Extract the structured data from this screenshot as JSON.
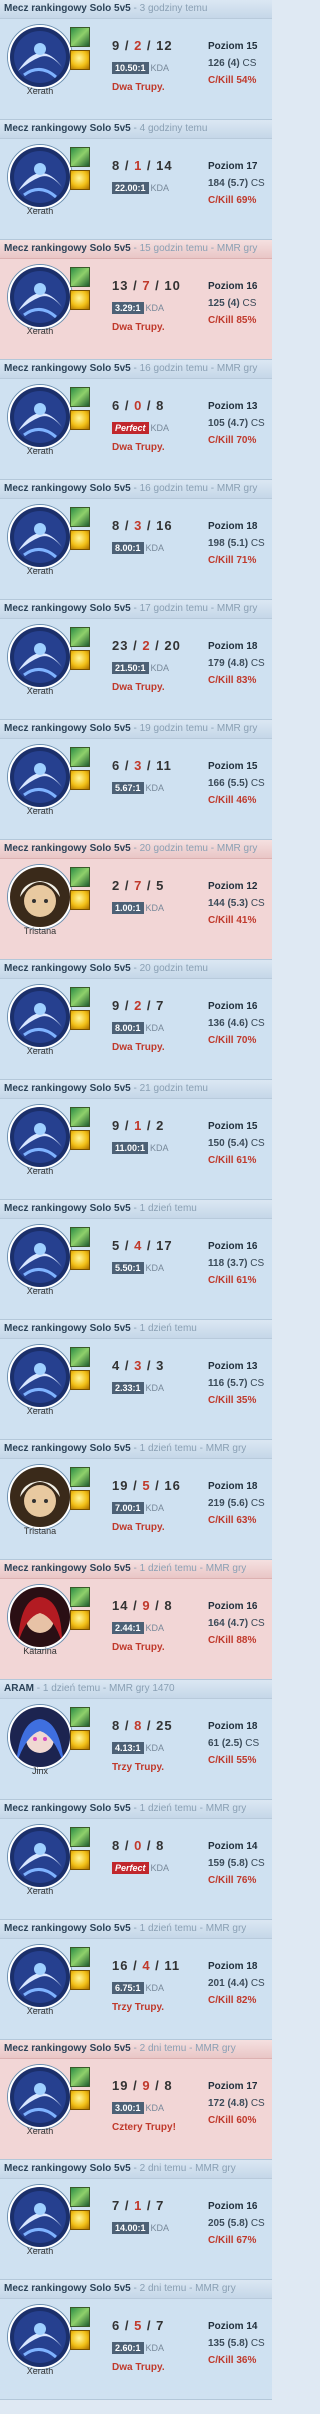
{
  "matches": [
    {
      "result": "win",
      "queue": "Mecz rankingowy Solo 5v5",
      "ago": " - 3 godziny temu",
      "champion": "Xerath",
      "kda": {
        "k": "9",
        "d": "2",
        "a": "12"
      },
      "ratio": "10.50:1",
      "ratio_label": "KDA",
      "multikill": "Dwa Trupy.",
      "level": "Poziom 15",
      "cs": "126 (4)",
      "cs_label": "CS",
      "ckill": "C/Kill 54%"
    },
    {
      "result": "win",
      "queue": "Mecz rankingowy Solo 5v5",
      "ago": " - 4 godziny temu",
      "champion": "Xerath",
      "kda": {
        "k": "8",
        "d": "1",
        "a": "14"
      },
      "ratio": "22.00:1",
      "ratio_label": "KDA",
      "multikill": "",
      "level": "Poziom 17",
      "cs": "184 (5.7)",
      "cs_label": "CS",
      "ckill": "C/Kill 69%"
    },
    {
      "result": "loss",
      "queue": "Mecz rankingowy Solo 5v5",
      "ago": " - 15 godzin temu - MMR gry",
      "champion": "Xerath",
      "kda": {
        "k": "13",
        "d": "7",
        "a": "10"
      },
      "ratio": "3.29:1",
      "ratio_label": "KDA",
      "multikill": "Dwa Trupy.",
      "level": "Poziom 16",
      "cs": "125 (4)",
      "cs_label": "CS",
      "ckill": "C/Kill 85%"
    },
    {
      "result": "win",
      "queue": "Mecz rankingowy Solo 5v5",
      "ago": " - 16 godzin temu - MMR gry",
      "champion": "Xerath",
      "kda": {
        "k": "6",
        "d": "0",
        "a": "8"
      },
      "ratio": "Perfect",
      "ratio_label": "KDA",
      "multikill": "Dwa Trupy.",
      "level": "Poziom 13",
      "cs": "105 (4.7)",
      "cs_label": "CS",
      "ckill": "C/Kill 70%"
    },
    {
      "result": "win",
      "queue": "Mecz rankingowy Solo 5v5",
      "ago": " - 16 godzin temu - MMR gry",
      "champion": "Xerath",
      "kda": {
        "k": "8",
        "d": "3",
        "a": "16"
      },
      "ratio": "8.00:1",
      "ratio_label": "KDA",
      "multikill": "",
      "level": "Poziom 18",
      "cs": "198 (5.1)",
      "cs_label": "CS",
      "ckill": "C/Kill 71%"
    },
    {
      "result": "win",
      "queue": "Mecz rankingowy Solo 5v5",
      "ago": " - 17 godzin temu - MMR gry",
      "champion": "Xerath",
      "kda": {
        "k": "23",
        "d": "2",
        "a": "20"
      },
      "ratio": "21.50:1",
      "ratio_label": "KDA",
      "multikill": "Dwa Trupy.",
      "level": "Poziom 18",
      "cs": "179 (4.8)",
      "cs_label": "CS",
      "ckill": "C/Kill 83%"
    },
    {
      "result": "win",
      "queue": "Mecz rankingowy Solo 5v5",
      "ago": " - 19 godzin temu - MMR gry",
      "champion": "Xerath",
      "kda": {
        "k": "6",
        "d": "3",
        "a": "11"
      },
      "ratio": "5.67:1",
      "ratio_label": "KDA",
      "multikill": "",
      "level": "Poziom 15",
      "cs": "166 (5.5)",
      "cs_label": "CS",
      "ckill": "C/Kill 46%"
    },
    {
      "result": "loss",
      "queue": "Mecz rankingowy Solo 5v5",
      "ago": " - 20 godzin temu - MMR gry",
      "champion": "Tristana",
      "kda": {
        "k": "2",
        "d": "7",
        "a": "5"
      },
      "ratio": "1.00:1",
      "ratio_label": "KDA",
      "multikill": "",
      "level": "Poziom 12",
      "cs": "144 (5.3)",
      "cs_label": "CS",
      "ckill": "C/Kill 41%"
    },
    {
      "result": "win",
      "queue": "Mecz rankingowy Solo 5v5",
      "ago": " - 20 godzin temu",
      "champion": "Xerath",
      "kda": {
        "k": "9",
        "d": "2",
        "a": "7"
      },
      "ratio": "8.00:1",
      "ratio_label": "KDA",
      "multikill": "Dwa Trupy.",
      "level": "Poziom 16",
      "cs": "136 (4.6)",
      "cs_label": "CS",
      "ckill": "C/Kill 70%"
    },
    {
      "result": "win",
      "queue": "Mecz rankingowy Solo 5v5",
      "ago": " - 21 godzin temu",
      "champion": "Xerath",
      "kda": {
        "k": "9",
        "d": "1",
        "a": "2"
      },
      "ratio": "11.00:1",
      "ratio_label": "KDA",
      "multikill": "",
      "level": "Poziom 15",
      "cs": "150 (5.4)",
      "cs_label": "CS",
      "ckill": "C/Kill 61%"
    },
    {
      "result": "win",
      "queue": "Mecz rankingowy Solo 5v5",
      "ago": " - 1 dzień temu",
      "champion": "Xerath",
      "kda": {
        "k": "5",
        "d": "4",
        "a": "17"
      },
      "ratio": "5.50:1",
      "ratio_label": "KDA",
      "multikill": "",
      "level": "Poziom 16",
      "cs": "118 (3.7)",
      "cs_label": "CS",
      "ckill": "C/Kill 61%"
    },
    {
      "result": "win",
      "queue": "Mecz rankingowy Solo 5v5",
      "ago": " - 1 dzień temu",
      "champion": "Xerath",
      "kda": {
        "k": "4",
        "d": "3",
        "a": "3"
      },
      "ratio": "2.33:1",
      "ratio_label": "KDA",
      "multikill": "",
      "level": "Poziom 13",
      "cs": "116 (5.7)",
      "cs_label": "CS",
      "ckill": "C/Kill 35%"
    },
    {
      "result": "win",
      "queue": "Mecz rankingowy Solo 5v5",
      "ago": " - 1 dzień temu - MMR gry",
      "champion": "Tristana",
      "kda": {
        "k": "19",
        "d": "5",
        "a": "16"
      },
      "ratio": "7.00:1",
      "ratio_label": "KDA",
      "multikill": "Dwa Trupy.",
      "level": "Poziom 18",
      "cs": "219 (5.6)",
      "cs_label": "CS",
      "ckill": "C/Kill 63%"
    },
    {
      "result": "loss",
      "queue": "Mecz rankingowy Solo 5v5",
      "ago": " - 1 dzień temu - MMR gry",
      "champion": "Katarina",
      "kda": {
        "k": "14",
        "d": "9",
        "a": "8"
      },
      "ratio": "2.44:1",
      "ratio_label": "KDA",
      "multikill": "Dwa Trupy.",
      "level": "Poziom 16",
      "cs": "164 (4.7)",
      "cs_label": "CS",
      "ckill": "C/Kill 88%"
    },
    {
      "result": "win",
      "queue": "ARAM",
      "ago": " - 1 dzień temu - MMR gry 1470",
      "champion": "Jinx",
      "kda": {
        "k": "8",
        "d": "8",
        "a": "25"
      },
      "ratio": "4.13:1",
      "ratio_label": "KDA",
      "multikill": "Trzy Trupy.",
      "level": "Poziom 18",
      "cs": "61 (2.5)",
      "cs_label": "CS",
      "ckill": "C/Kill 55%"
    },
    {
      "result": "win",
      "queue": "Mecz rankingowy Solo 5v5",
      "ago": " - 1 dzień temu - MMR gry",
      "champion": "Xerath",
      "kda": {
        "k": "8",
        "d": "0",
        "a": "8"
      },
      "ratio": "Perfect",
      "ratio_label": "KDA",
      "multikill": "",
      "level": "Poziom 14",
      "cs": "159 (5.8)",
      "cs_label": "CS",
      "ckill": "C/Kill 76%"
    },
    {
      "result": "win",
      "queue": "Mecz rankingowy Solo 5v5",
      "ago": " - 1 dzień temu - MMR gry",
      "champion": "Xerath",
      "kda": {
        "k": "16",
        "d": "4",
        "a": "11"
      },
      "ratio": "6.75:1",
      "ratio_label": "KDA",
      "multikill": "Trzy Trupy.",
      "level": "Poziom 18",
      "cs": "201 (4.4)",
      "cs_label": "CS",
      "ckill": "C/Kill 82%"
    },
    {
      "result": "loss",
      "queue": "Mecz rankingowy Solo 5v5",
      "ago": " - 2 dni temu - MMR gry",
      "champion": "Xerath",
      "kda": {
        "k": "19",
        "d": "9",
        "a": "8"
      },
      "ratio": "3.00:1",
      "ratio_label": "KDA",
      "multikill": "Cztery Trupy!",
      "level": "Poziom 17",
      "cs": "172 (4.8)",
      "cs_label": "CS",
      "ckill": "C/Kill 60%"
    },
    {
      "result": "win",
      "queue": "Mecz rankingowy Solo 5v5",
      "ago": " - 2 dni temu - MMR gry",
      "champion": "Xerath",
      "kda": {
        "k": "7",
        "d": "1",
        "a": "7"
      },
      "ratio": "14.00:1",
      "ratio_label": "KDA",
      "multikill": "",
      "level": "Poziom 16",
      "cs": "205 (5.8)",
      "cs_label": "CS",
      "ckill": "C/Kill 67%"
    },
    {
      "result": "win",
      "queue": "Mecz rankingowy Solo 5v5",
      "ago": " - 2 dni temu - MMR gry",
      "champion": "Xerath",
      "kda": {
        "k": "6",
        "d": "5",
        "a": "7"
      },
      "ratio": "2.60:1",
      "ratio_label": "KDA",
      "multikill": "Dwa Trupy.",
      "level": "Poziom 14",
      "cs": "135 (5.8)",
      "cs_label": "CS",
      "ckill": "C/Kill 36%"
    }
  ],
  "colors": {
    "win_bg": "#cfe1f1",
    "loss_bg": "#f2d6d6",
    "deaths": "#c0392b",
    "cs": "#2e8b3a",
    "ckill": "#c0392b"
  },
  "icons": {
    "champion": "champion-portrait",
    "spell_1": "summoner-spell-icon",
    "spell_2": "summoner-spell-icon"
  }
}
